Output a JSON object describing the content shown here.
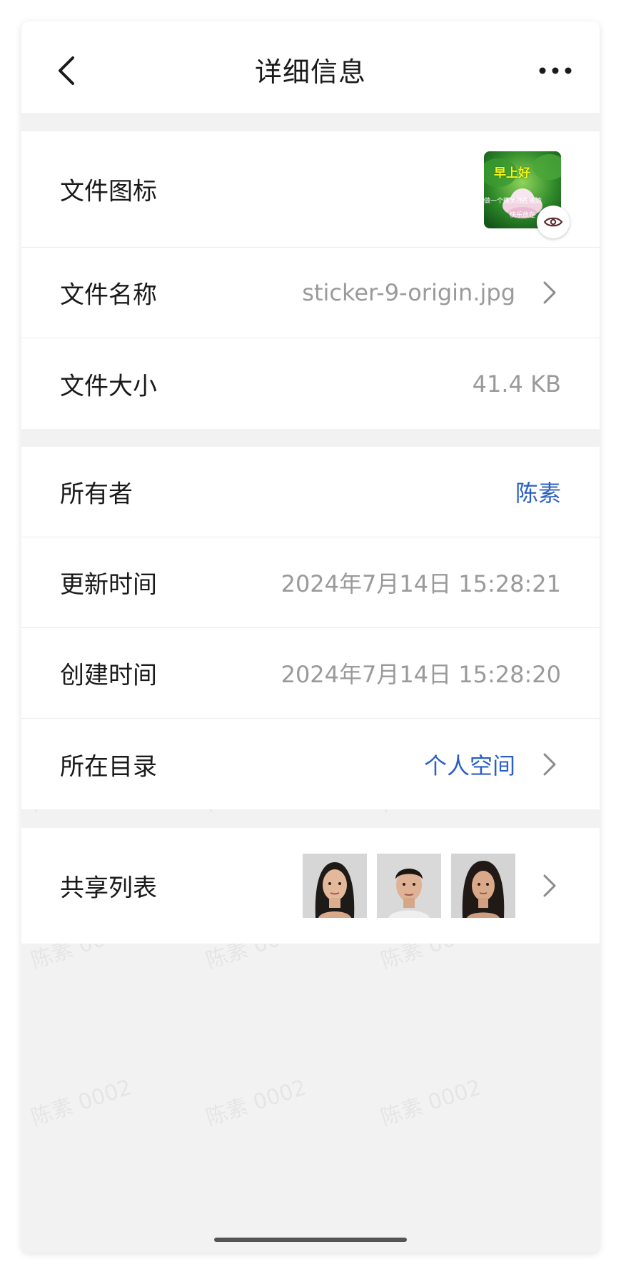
{
  "navbar": {
    "title": "详细信息"
  },
  "file_info": {
    "icon_label": "文件图标",
    "thumbnail": {
      "title_text": "早上好",
      "line1": "做一个微笑挂在嘴边",
      "line2": "快乐放在",
      "preview_icon": "eye-icon"
    },
    "name_label": "文件名称",
    "name_value": "sticker-9-origin.jpg",
    "size_label": "文件大小",
    "size_value": "41.4 KB"
  },
  "meta": {
    "owner_label": "所有者",
    "owner_value": "陈素",
    "updated_label": "更新时间",
    "updated_value": "2024年7月14日 15:28:21",
    "created_label": "创建时间",
    "created_value": "2024年7月14日 15:28:20",
    "folder_label": "所在目录",
    "folder_value": "个人空间"
  },
  "share": {
    "label": "共享列表",
    "avatars": [
      "avatar-woman-1",
      "avatar-man",
      "avatar-woman-2"
    ]
  },
  "watermark_text": "陈素 0002",
  "colors": {
    "link": "#2a5fc4",
    "value_gray": "#9a9a9a",
    "background": "#f2f2f2"
  }
}
